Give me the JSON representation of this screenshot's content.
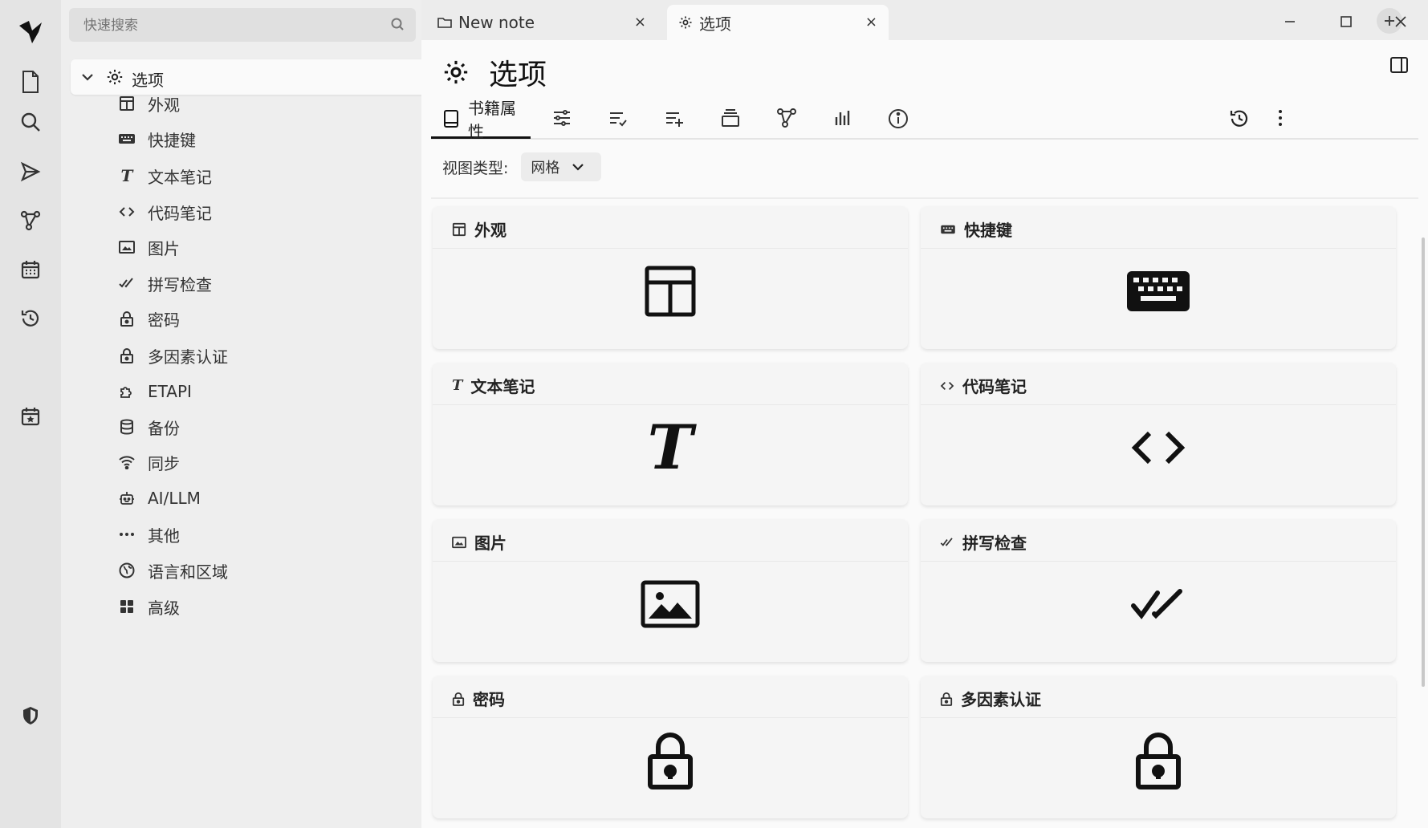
{
  "tree": {
    "search_placeholder": "快速搜索",
    "root_label": "选项",
    "items": [
      {
        "label": "外观",
        "icon": "layout-icon"
      },
      {
        "label": "快捷键",
        "icon": "keyboard-icon"
      },
      {
        "label": "文本笔记",
        "icon": "text-icon"
      },
      {
        "label": "代码笔记",
        "icon": "code-icon"
      },
      {
        "label": "图片",
        "icon": "image-icon"
      },
      {
        "label": "拼写检查",
        "icon": "check-double-icon"
      },
      {
        "label": "密码",
        "icon": "lock-icon"
      },
      {
        "label": "多因素认证",
        "icon": "lock-icon"
      },
      {
        "label": "ETAPI",
        "icon": "extension-icon"
      },
      {
        "label": "备份",
        "icon": "database-icon"
      },
      {
        "label": "同步",
        "icon": "wifi-icon"
      },
      {
        "label": "AI/LLM",
        "icon": "robot-icon"
      },
      {
        "label": "其他",
        "icon": "dots-icon"
      },
      {
        "label": "语言和区域",
        "icon": "globe-icon"
      },
      {
        "label": "高级",
        "icon": "grid-icon"
      }
    ]
  },
  "tabs": [
    {
      "label": "New note",
      "close": "×"
    },
    {
      "label": "选项",
      "close": "×"
    }
  ],
  "main": {
    "title": "选项",
    "ribbon_active_label": "书籍属性",
    "view_type_label": "视图类型:",
    "view_type_value": "网格"
  },
  "cards": [
    {
      "title": "外观"
    },
    {
      "title": "快捷键"
    },
    {
      "title": "文本笔记"
    },
    {
      "title": "代码笔记"
    },
    {
      "title": "图片"
    },
    {
      "title": "拼写检查"
    },
    {
      "title": "密码"
    },
    {
      "title": "多因素认证"
    }
  ]
}
